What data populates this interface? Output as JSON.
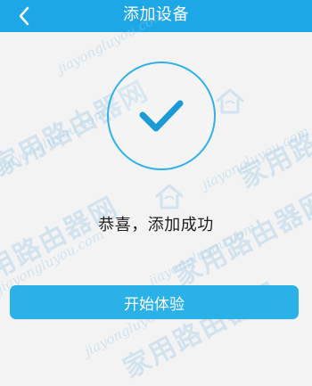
{
  "header": {
    "title": "添加设备"
  },
  "watermark": {
    "brand": "家用路由器网",
    "site": "jiayongluyou.com"
  },
  "main": {
    "message": "恭喜，添加成功"
  },
  "button": {
    "label": "开始体验"
  },
  "colors": {
    "primary": "#1ea7e6",
    "button": "#29b1e8",
    "background": "#f3f3f3",
    "text": "#1f1f1f"
  },
  "icons": {
    "back": "chevron-left-icon",
    "success": "check-icon",
    "watermark": "router-logo-icon"
  }
}
